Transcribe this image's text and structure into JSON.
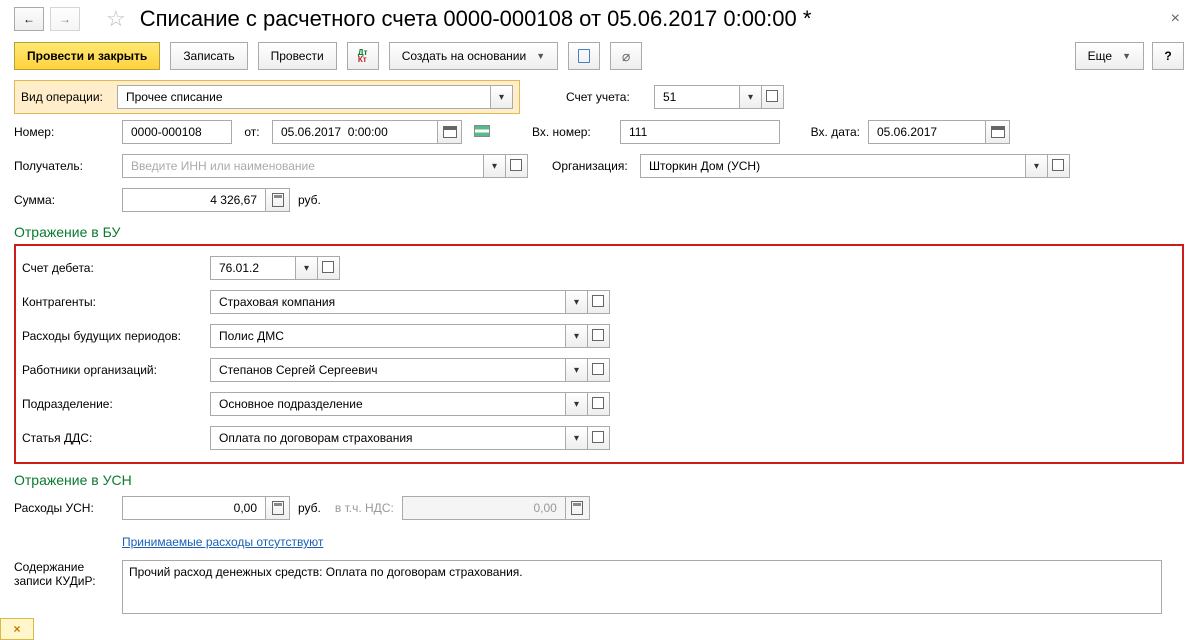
{
  "header": {
    "title": "Списание с расчетного счета 0000-000108 от 05.06.2017 0:00:00 *"
  },
  "toolbar": {
    "post_and_close": "Провести и закрыть",
    "save": "Записать",
    "post": "Провести",
    "create_based_on": "Создать на основании",
    "more": "Еще",
    "help": "?"
  },
  "form": {
    "operation_type_label": "Вид операции:",
    "operation_type_value": "Прочее списание",
    "account_label": "Счет учета:",
    "account_value": "51",
    "number_label": "Номер:",
    "number_value": "0000-000108",
    "from_label": "от:",
    "date_value": "05.06.2017  0:00:00",
    "in_number_label": "Вх. номер:",
    "in_number_value": "111",
    "in_date_label": "Вх. дата:",
    "in_date_value": "05.06.2017",
    "recipient_label": "Получатель:",
    "recipient_placeholder": "Введите ИНН или наименование",
    "org_label": "Организация:",
    "org_value": "Шторкин Дом (УСН)",
    "sum_label": "Сумма:",
    "sum_value": "4 326,67",
    "rub": "руб."
  },
  "accounting": {
    "section_bu": "Отражение в БУ",
    "debit_account_label": "Счет дебета:",
    "debit_account_value": "76.01.2",
    "counterparty_label": "Контрагенты:",
    "counterparty_value": "Страховая компания",
    "deferred_label": "Расходы будущих периодов:",
    "deferred_value": "Полис ДМС",
    "employee_label": "Работники организаций:",
    "employee_value": "Степанов Сергей Сергеевич",
    "division_label": "Подразделение:",
    "division_value": "Основное подразделение",
    "dds_label": "Статья ДДС:",
    "dds_value": "Оплата по договорам страхования"
  },
  "usn": {
    "section": "Отражение в УСН",
    "expenses_label": "Расходы УСН:",
    "expenses_value": "0,00",
    "rub": "руб.",
    "vat_label": "в т.ч. НДС:",
    "vat_value": "0,00",
    "expenses_note": "Принимаемые расходы отсутствуют",
    "kudir_label": "Содержание записи КУДиР:",
    "kudir_value": "Прочий расход денежных средств: Оплата по договорам страхования."
  },
  "bottom_tab": "×"
}
